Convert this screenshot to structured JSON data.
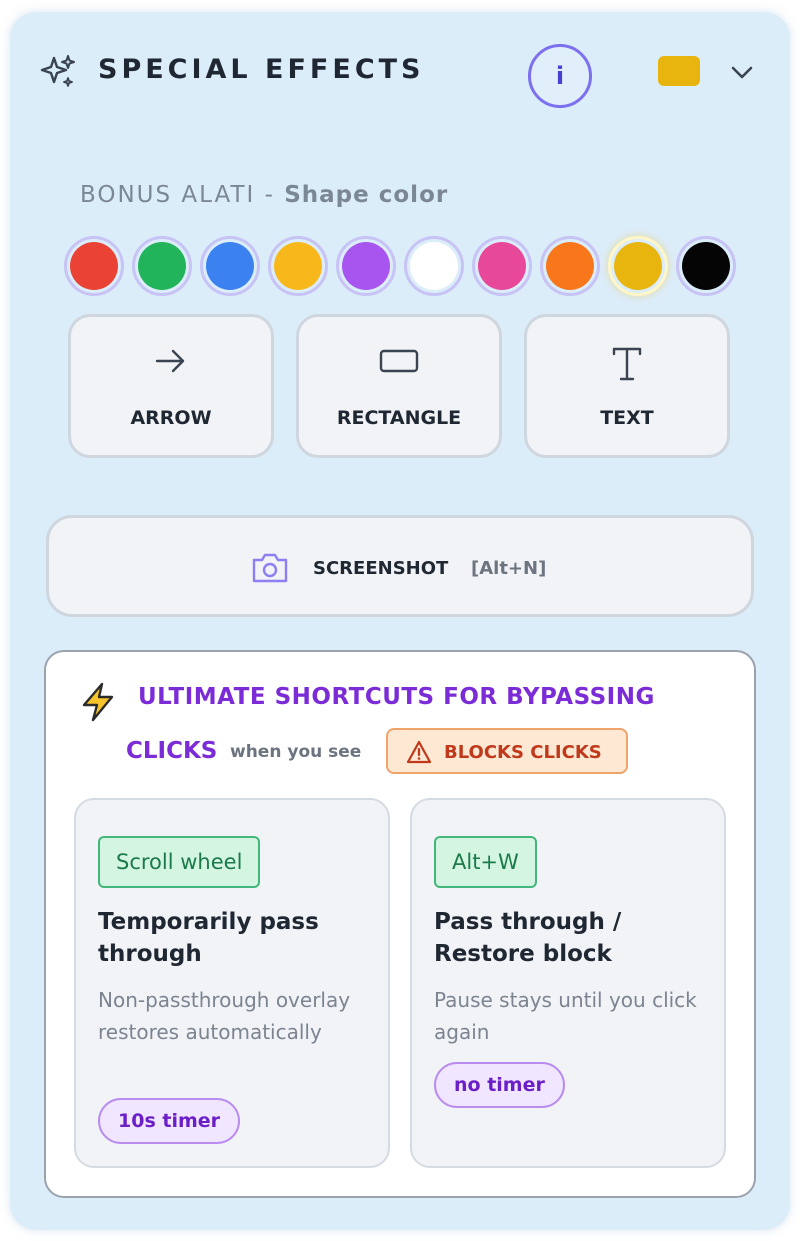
{
  "header": {
    "title": "SPECIAL EFFECTS",
    "info_label": "i",
    "selected_color": "#e8b50f",
    "icons": {
      "sparkle": "sparkles-icon",
      "chevron": "chevron-down-icon"
    }
  },
  "palette": {
    "label": "BONUS ALATI",
    "label_separator": " - ",
    "sublabel": "Shape color",
    "colors": [
      "#ea4335",
      "#22b45a",
      "#3b82f0",
      "#f8b81c",
      "#a855f0",
      "#ffffff",
      "#e8489a",
      "#f8771a",
      "#e8b50f",
      "#050505"
    ],
    "selected_index": 8
  },
  "tools": [
    {
      "label": "ARROW",
      "icon": "arrow-right-icon"
    },
    {
      "label": "RECTANGLE",
      "icon": "rectangle-icon"
    },
    {
      "label": "TEXT",
      "icon": "text-icon"
    }
  ],
  "screenshot": {
    "label": "SCREENSHOT",
    "shortcut": "[Alt+N]",
    "icon": "camera-icon"
  },
  "shortcuts": {
    "title_line1": "ULTIMATE SHORTCUTS FOR BYPASSING",
    "title_line2": "CLICKS",
    "when_text": "when you see",
    "badge_text": "BLOCKS CLICKS",
    "colors": {
      "accent": "#7b2cd6",
      "warning": "#c0391b"
    },
    "cards": [
      {
        "key": "Scroll wheel",
        "title": "Temporarily pass through",
        "description": "Non-passthrough overlay restores automatically",
        "timer": "10s timer"
      },
      {
        "key": "Alt+W",
        "title": "Pass through / Restore block",
        "description": "Pause stays until you click again",
        "timer": "no timer"
      }
    ]
  }
}
